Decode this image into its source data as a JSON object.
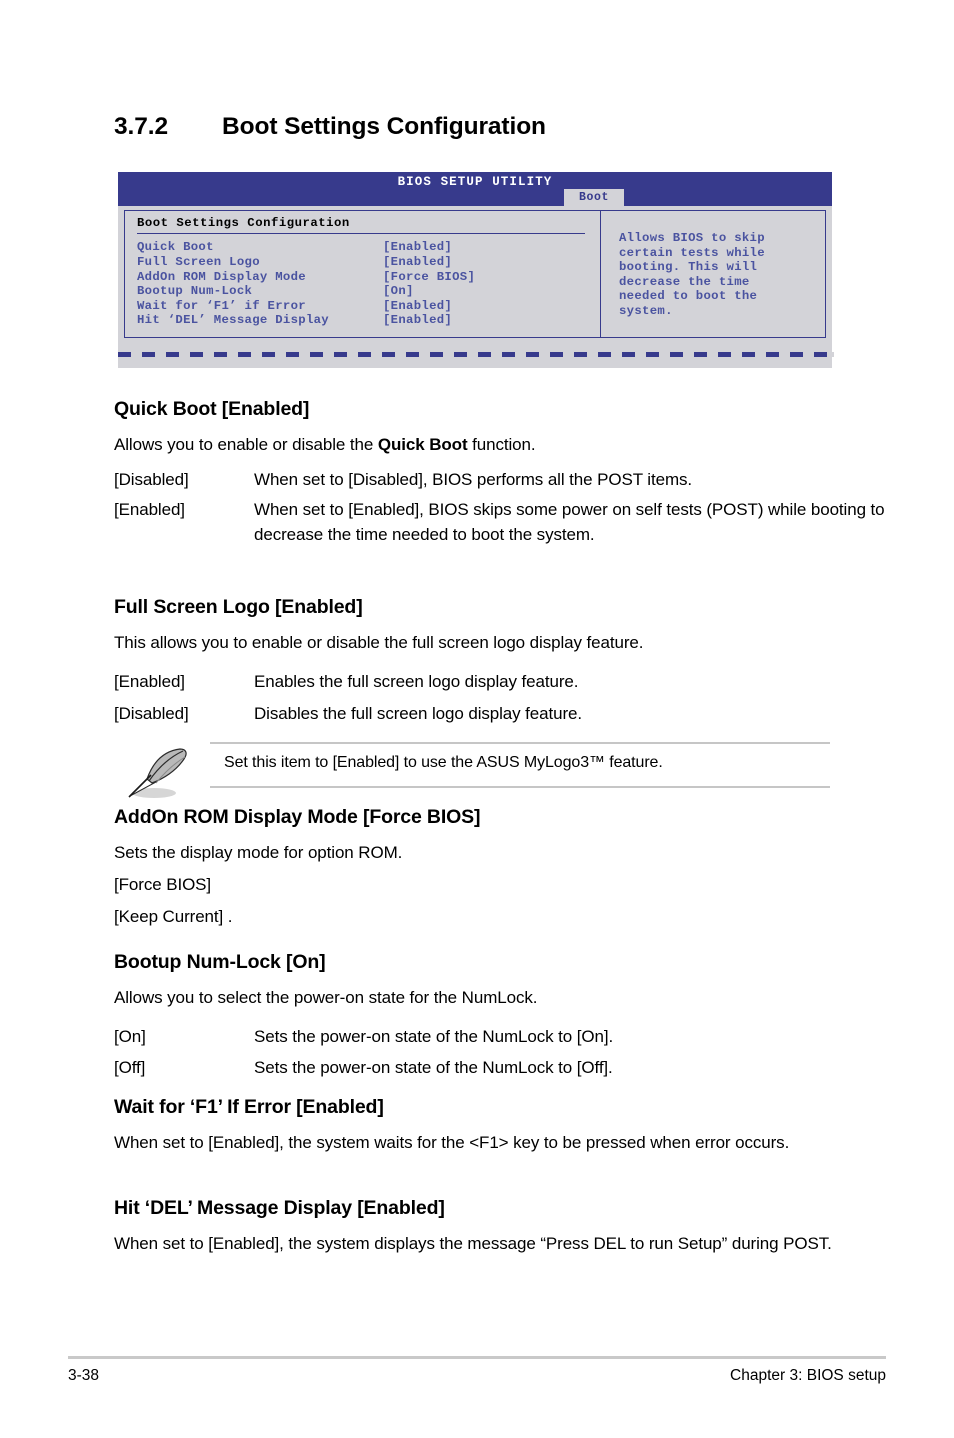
{
  "section": {
    "number": "3.7.2",
    "title": "Boot Settings Configuration"
  },
  "bios": {
    "title": "BIOS SETUP UTILITY",
    "active_tab": "Boot",
    "panel_title": "Boot Settings Configuration",
    "items": [
      {
        "label": "Quick Boot",
        "value": "[Enabled]"
      },
      {
        "label": "Full Screen Logo",
        "value": "[Enabled]"
      },
      {
        "label": "AddOn ROM Display Mode",
        "value": "[Force BIOS]"
      },
      {
        "label": "Bootup Num-Lock",
        "value": "[On]"
      },
      {
        "label": "Wait for ‘F1’ if Error",
        "value": "[Enabled]"
      },
      {
        "label": "Hit ‘DEL’ Message Display",
        "value": "[Enabled]"
      }
    ],
    "help_text": "Allows BIOS to skip\ncertain tests while\nbooting. This will\ndecrease the time\nneeded to boot the\nsystem.",
    "colors": {
      "header_bg": "#373a8c",
      "body_bg": "#d3d3d8",
      "text_blue": "#4a53a0",
      "border": "#373a8c"
    }
  },
  "sections": {
    "quick_boot": {
      "heading": "Quick Boot [Enabled]",
      "intro_pre": "Allows you to enable or disable the ",
      "intro_bold": "Quick Boot",
      "intro_post": " function.",
      "defs": [
        {
          "term": "[Disabled]",
          "desc": "When set to [Disabled], BIOS performs all the POST items."
        },
        {
          "term": "[Enabled]",
          "desc": "When set to [Enabled], BIOS skips some power on self tests (POST) while booting to decrease the time needed to boot the system."
        }
      ]
    },
    "full_screen_logo": {
      "heading": "Full Screen Logo [Enabled]",
      "intro": "This allows you to enable or disable the full screen logo display feature.",
      "defs": [
        {
          "term": "[Enabled]",
          "desc": "Enables the full screen logo display feature."
        },
        {
          "term": "[Disabled]",
          "desc": "Disables the full screen logo display feature."
        }
      ],
      "note": "Set this item to [Enabled] to use the ASUS MyLogo3™ feature."
    },
    "addon_rom": {
      "heading": "AddOn ROM Display Mode [Force BIOS]",
      "intro": "Sets the display mode for option ROM.",
      "options": [
        "[Force BIOS]",
        "[Keep Current]  ."
      ]
    },
    "bootup_numlock": {
      "heading": "Bootup Num-Lock [On]",
      "intro": "Allows you to select the power-on state for the NumLock.",
      "defs": [
        {
          "term": "[On]",
          "desc": "Sets the power-on state of the NumLock to [On]."
        },
        {
          "term": "[Off]",
          "desc": "Sets the power-on state of the NumLock to [Off]."
        }
      ]
    },
    "wait_f1": {
      "heading": "Wait for ‘F1’ If Error [Enabled]",
      "intro": "When set to [Enabled], the system waits for the <F1> key to be pressed when error occurs."
    },
    "hit_del": {
      "heading": "Hit ‘DEL’ Message Display [Enabled]",
      "intro": "When set to [Enabled], the system displays the message “Press DEL to run Setup” during POST."
    }
  },
  "footer": {
    "page_number": "3-38",
    "chapter": "Chapter 3: BIOS setup"
  }
}
